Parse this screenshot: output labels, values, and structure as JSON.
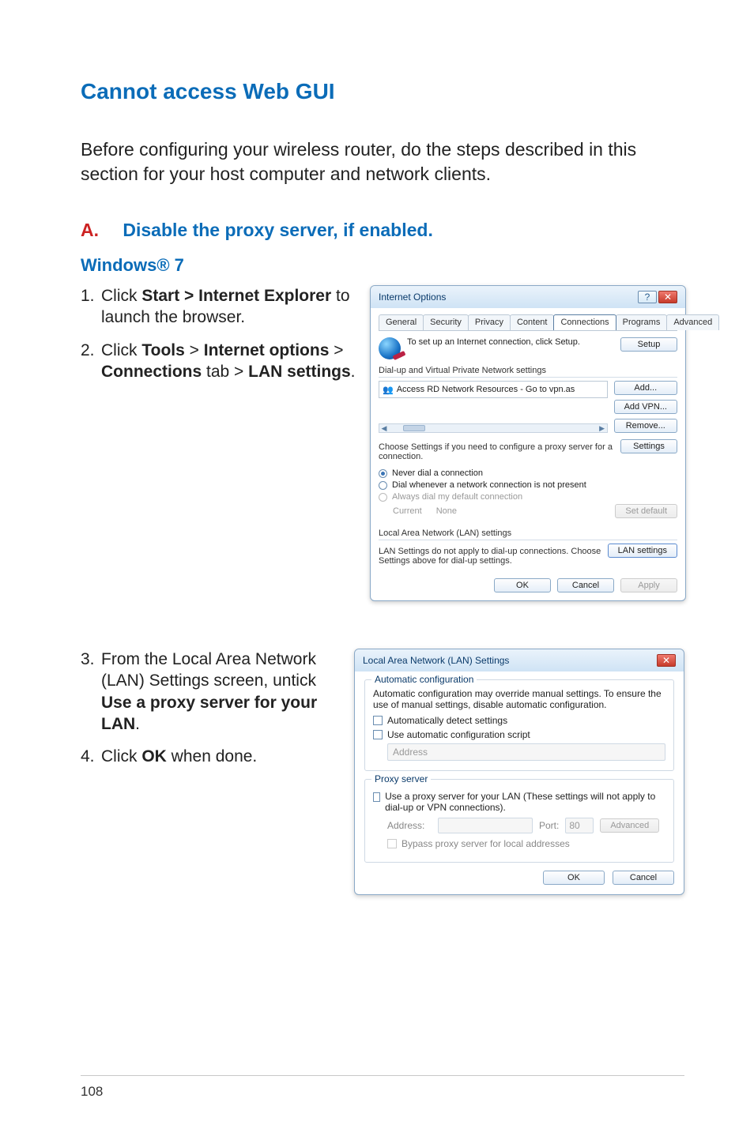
{
  "page": {
    "title": "Cannot access Web GUI",
    "intro": "Before configuring your wireless router, do the steps described in this section for your host computer and network clients.",
    "section_a_label": "A.",
    "section_a_title": "Disable the proxy server, if enabled.",
    "win7_heading": "Windows® 7",
    "steps_a": [
      {
        "num": "1.",
        "pre": "Click ",
        "bold": "Start > Internet Explorer",
        "post": " to launch the browser."
      },
      {
        "num": "2.",
        "pre": "Click ",
        "bold1": "Tools",
        "mid1": " > ",
        "bold2": "Internet options",
        "mid2": " > ",
        "bold3": "Connections",
        "mid3": " tab > ",
        "bold4": "LAN settings",
        "post": "."
      }
    ],
    "steps_b": [
      {
        "num": "3.",
        "pre": "From the Local Area Network (LAN) Settings screen, untick ",
        "bold": "Use a proxy server for your LAN",
        "post": "."
      },
      {
        "num": "4.",
        "pre": "Click ",
        "bold": "OK",
        "post": " when done."
      }
    ],
    "page_number": "108"
  },
  "internet_options": {
    "title": "Internet Options",
    "tabs": [
      "General",
      "Security",
      "Privacy",
      "Content",
      "Connections",
      "Programs",
      "Advanced"
    ],
    "active_tab": "Connections",
    "setup_text": "To set up an Internet connection, click Setup.",
    "setup_btn": "Setup",
    "dialup_label": "Dial-up and Virtual Private Network settings",
    "vpn_item": "Access RD Network Resources - Go to vpn.as",
    "add_btn": "Add...",
    "add_vpn_btn": "Add VPN...",
    "remove_btn": "Remove...",
    "settings_note": "Choose Settings if you need to configure a proxy server for a connection.",
    "settings_btn": "Settings",
    "radio_never": "Never dial a connection",
    "radio_dial_when": "Dial whenever a network connection is not present",
    "radio_always": "Always dial my default connection",
    "current_label": "Current",
    "current_value": "None",
    "set_default_btn": "Set default",
    "lan_label": "Local Area Network (LAN) settings",
    "lan_note": "LAN Settings do not apply to dial-up connections. Choose Settings above for dial-up settings.",
    "lan_settings_btn": "LAN settings",
    "ok_btn": "OK",
    "cancel_btn": "Cancel",
    "apply_btn": "Apply"
  },
  "lan_settings": {
    "title": "Local Area Network (LAN) Settings",
    "auto_legend": "Automatic configuration",
    "auto_desc": "Automatic configuration may override manual settings.  To ensure the use of manual settings, disable automatic configuration.",
    "auto_detect": "Automatically detect settings",
    "auto_script": "Use automatic configuration script",
    "address_label": "Address",
    "proxy_legend": "Proxy server",
    "proxy_use": "Use a proxy server for your LAN (These settings will not apply to dial-up or VPN connections).",
    "proxy_address_label": "Address:",
    "proxy_port_label": "Port:",
    "proxy_port_value": "80",
    "advanced_btn": "Advanced",
    "bypass": "Bypass proxy server for local addresses",
    "ok_btn": "OK",
    "cancel_btn": "Cancel"
  }
}
